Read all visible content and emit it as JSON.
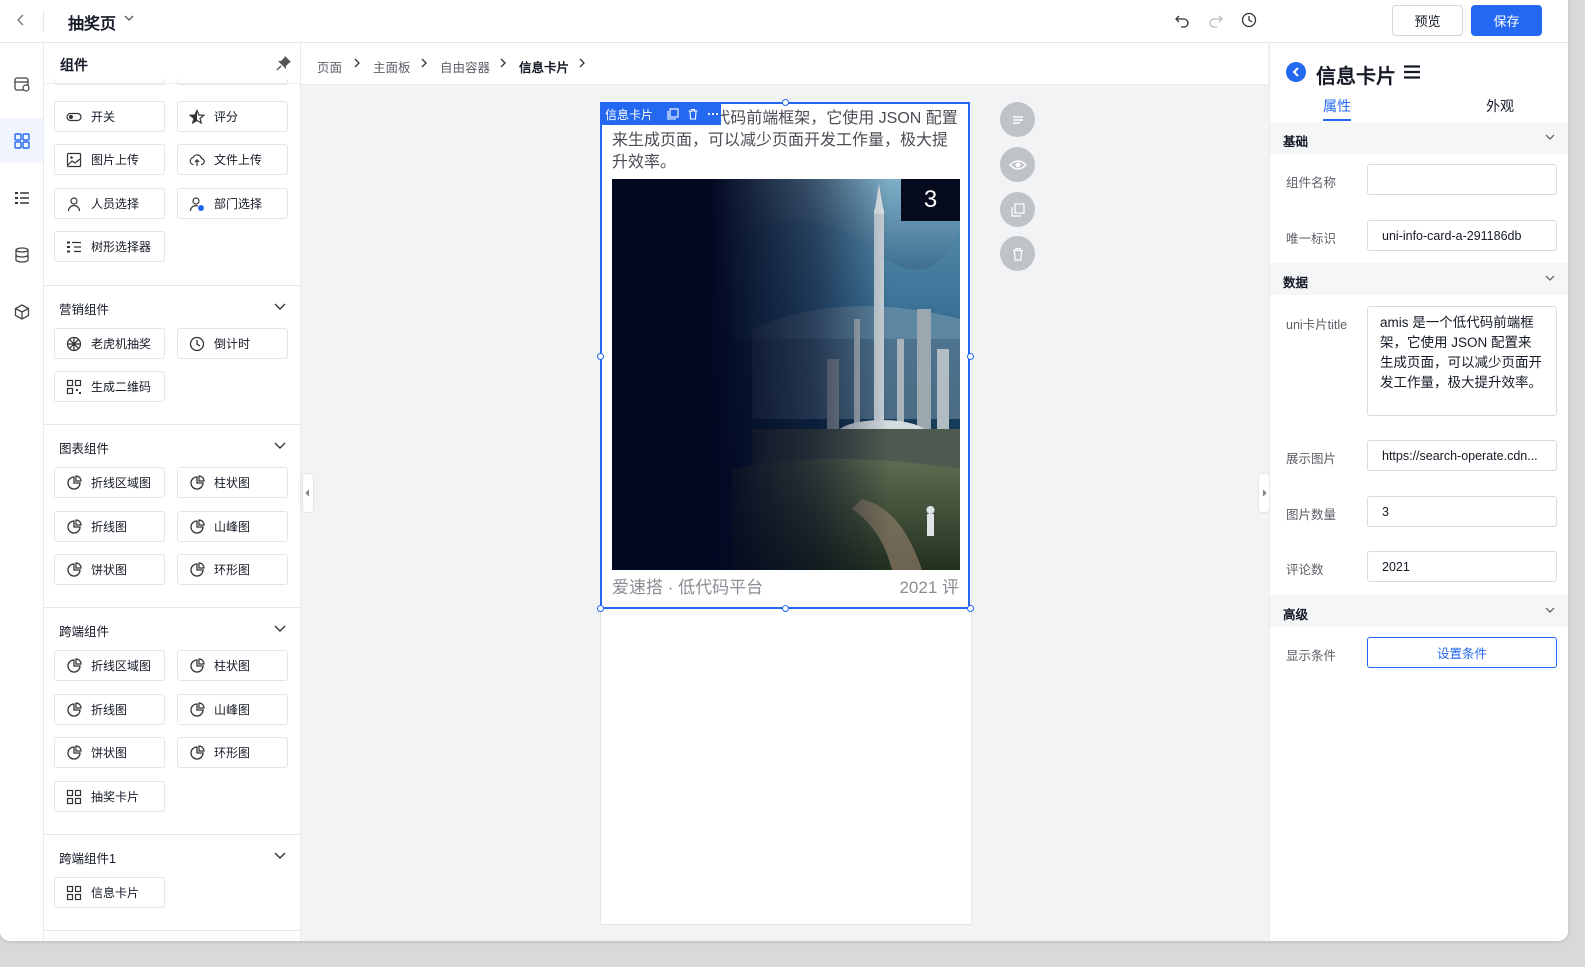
{
  "header": {
    "page_title": "抽奖页",
    "preview_label": "预览",
    "save_label": "保存"
  },
  "components_panel": {
    "title": "组件",
    "basic_items": [
      {
        "label": "开关",
        "icon": "toggle-icon"
      },
      {
        "label": "评分",
        "icon": "star-rating-icon"
      },
      {
        "label": "图片上传",
        "icon": "image-upload-icon"
      },
      {
        "label": "文件上传",
        "icon": "cloud-upload-icon"
      },
      {
        "label": "人员选择",
        "icon": "person-icon"
      },
      {
        "label": "部门选择",
        "icon": "department-icon"
      },
      {
        "label": "树形选择器",
        "icon": "tree-list-icon"
      }
    ],
    "groups": [
      {
        "title": "营销组件",
        "items": [
          {
            "label": "老虎机抽奖",
            "icon": "slot-machine-icon"
          },
          {
            "label": "倒计时",
            "icon": "clock-icon"
          },
          {
            "label": "生成二维码",
            "icon": "qrcode-icon"
          }
        ]
      },
      {
        "title": "图表组件",
        "items": [
          {
            "label": "折线区域图",
            "icon": "chart-icon"
          },
          {
            "label": "柱状图",
            "icon": "chart-icon"
          },
          {
            "label": "折线图",
            "icon": "chart-icon"
          },
          {
            "label": "山峰图",
            "icon": "chart-icon"
          },
          {
            "label": "饼状图",
            "icon": "chart-icon"
          },
          {
            "label": "环形图",
            "icon": "chart-icon"
          }
        ]
      },
      {
        "title": "跨端组件",
        "items": [
          {
            "label": "折线区域图",
            "icon": "chart-icon"
          },
          {
            "label": "柱状图",
            "icon": "chart-icon"
          },
          {
            "label": "折线图",
            "icon": "chart-icon"
          },
          {
            "label": "山峰图",
            "icon": "chart-icon"
          },
          {
            "label": "饼状图",
            "icon": "chart-icon"
          },
          {
            "label": "环形图",
            "icon": "chart-icon"
          },
          {
            "label": "抽奖卡片",
            "icon": "grid-card-icon"
          }
        ]
      },
      {
        "title": "跨端组件1",
        "items": [
          {
            "label": "信息卡片",
            "icon": "grid-card-icon"
          }
        ]
      }
    ]
  },
  "breadcrumb": [
    "页面",
    "主面板",
    "自由容器",
    "信息卡片"
  ],
  "canvas": {
    "selected_tag": "信息卡片",
    "card": {
      "title_text": "amis 是一个低代码前端框架，它使用 JSON 配置来生成页面，可以减少页面开发工作量，极大提升效率。",
      "image_count": "3",
      "source": "爱速搭 · 低代码平台",
      "comments": "2021 评"
    }
  },
  "properties_panel": {
    "title": "信息卡片",
    "tabs": [
      "属性",
      "外观"
    ],
    "sections": {
      "basic": "基础",
      "data": "数据",
      "advanced": "高级"
    },
    "fields": {
      "name_label": "组件名称",
      "name_value": "",
      "id_label": "唯一标识",
      "id_value": "uni-info-card-a-291186db",
      "title_label": "uni卡片title",
      "title_value": "amis 是一个低代码前端框架，它使用 JSON 配置来生成页面，可以减少页面开发工作量，极大提升效率。",
      "image_label": "展示图片",
      "image_value": "https://search-operate.cdn...",
      "count_label": "图片数量",
      "count_value": "3",
      "comments_label": "评论数",
      "comments_value": "2021",
      "condition_label": "显示条件",
      "condition_button": "设置条件"
    }
  },
  "colors": {
    "accent": "#2468f2",
    "selection": "#2468f2"
  }
}
